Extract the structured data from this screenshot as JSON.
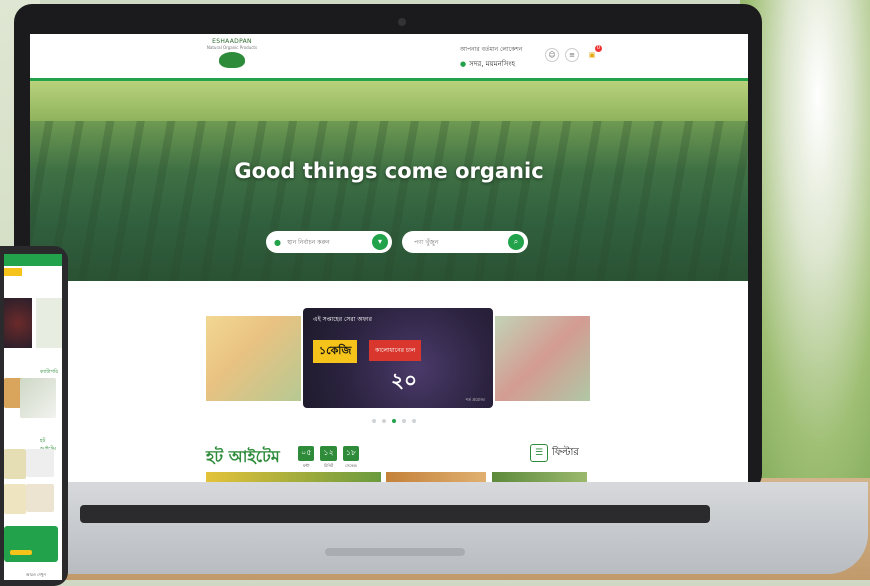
{
  "site": {
    "logo_text": "ESHAADPAN",
    "logo_tagline": "Natural Organic Products",
    "location_label": "আপনার বর্তমান লোকেশন",
    "location_value": "সদর, ময়মনসিংহ",
    "cart_count": "0"
  },
  "hero": {
    "title": "Good things come organic",
    "location_placeholder": "স্থান নির্বাচন করুন",
    "search_placeholder": "পণ্য খুঁজুন"
  },
  "carousel": {
    "caption": "এই সপ্তাহের সেরা অফার",
    "weight_badge": "১কেজি",
    "price_badge": "কালোধানের চাল",
    "price": "২০",
    "footer_note": "শর্ত প্রযোজ্য",
    "dots": 5,
    "active_dot": 3
  },
  "hot_items": {
    "title": "হট আইটেম",
    "timer": [
      {
        "value": "০৫",
        "label": "ঘন্টা"
      },
      {
        "value": "১২",
        "label": "মিনিট"
      },
      {
        "value": "১৮",
        "label": "সেকেন্ড"
      }
    ],
    "filter_label": "ফিল্টার"
  },
  "phone": {
    "section1_label": "ক্যাটাগরি",
    "section2_label": "হট আইটেম",
    "footer_text": "আরও দেখুন"
  },
  "colors": {
    "brand_green": "#22a24a",
    "accent_yellow": "#f5c31a",
    "badge_red": "#d9362e"
  }
}
